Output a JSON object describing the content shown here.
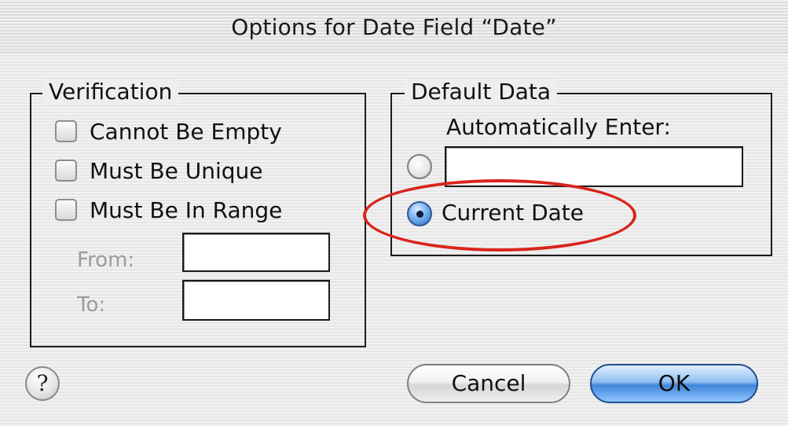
{
  "dialog": {
    "title": "Options for Date Field “Date”"
  },
  "verification": {
    "legend": "Verification",
    "options": [
      {
        "label": "Cannot Be Empty",
        "checked": false
      },
      {
        "label": "Must Be Unique",
        "checked": false
      },
      {
        "label": "Must Be In Range",
        "checked": false
      }
    ],
    "range": {
      "from_label": "From:",
      "from_value": "",
      "to_label": "To:",
      "to_value": ""
    }
  },
  "default_data": {
    "legend": "Default Data",
    "auto_enter_label": "Automatically Enter:",
    "auto_enter_value": "",
    "auto_enter_selected": false,
    "current_date_label": "Current Date",
    "current_date_selected": true
  },
  "buttons": {
    "help": "?",
    "cancel": "Cancel",
    "ok": "OK"
  },
  "colors": {
    "annotation": "#d9241c",
    "default_button": "#3f86d9"
  }
}
